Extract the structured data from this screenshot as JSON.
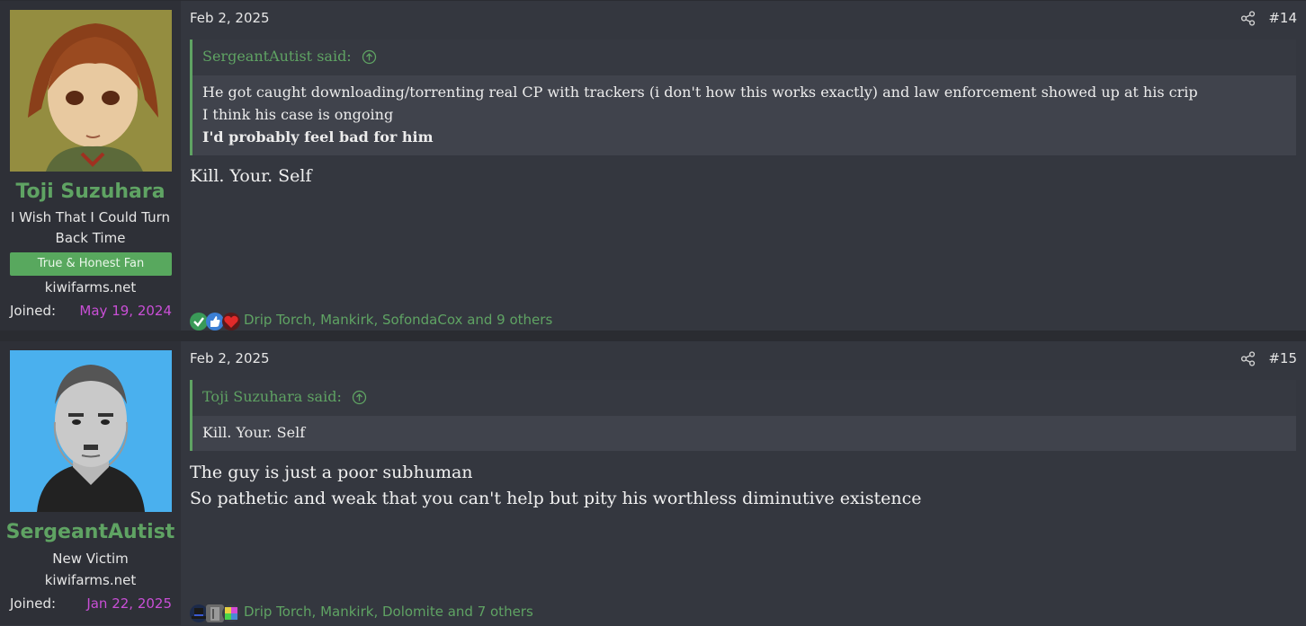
{
  "posts": [
    {
      "user": {
        "name": "Toji Suzuhara",
        "title": "I Wish That I Could Turn Back Time",
        "banner": "True & Honest Fan",
        "site": "kiwifarms.net",
        "joined_label": "Joined:",
        "joined_date": "May 19, 2024"
      },
      "date": "Feb 2, 2025",
      "number": "#14",
      "quote": {
        "author": "SergeantAutist said:",
        "lines": [
          "He got caught downloading/torrenting real CP with trackers (i don't how this works exactly) and law enforcement showed up at his crip",
          "I think his case is ongoing"
        ],
        "bold_line": "I'd probably feel bad for him"
      },
      "message": [
        "Kill. Your. Self"
      ],
      "reactions": {
        "icons": [
          "checkmark-reaction-icon",
          "thumbs-up-reaction-icon",
          "heart-reaction-icon"
        ],
        "text": "Drip Torch, Mankirk, SofondaCox and 9 others"
      }
    },
    {
      "user": {
        "name": "SergeantAutist",
        "title": "New Victim",
        "site": "kiwifarms.net",
        "joined_label": "Joined:",
        "joined_date": "Jan 22, 2025"
      },
      "date": "Feb 2, 2025",
      "number": "#15",
      "quote": {
        "author": "Toji Suzuhara said:",
        "lines": [
          "Kill. Your. Self"
        ]
      },
      "message": [
        "The guy is just a poor subhuman",
        "So pathetic and weak that you can't help but pity his worthless diminutive existence"
      ],
      "reactions": {
        "icons": [
          "hat-reaction-icon",
          "gray-reaction-icon",
          "puzzle-reaction-icon"
        ],
        "text": "Drip Torch, Mankirk, Dolomite and 7 others"
      }
    }
  ],
  "colors": {
    "accent_green": "#5fa363",
    "joined_date": "#c94fd6",
    "background": "#34373f"
  }
}
